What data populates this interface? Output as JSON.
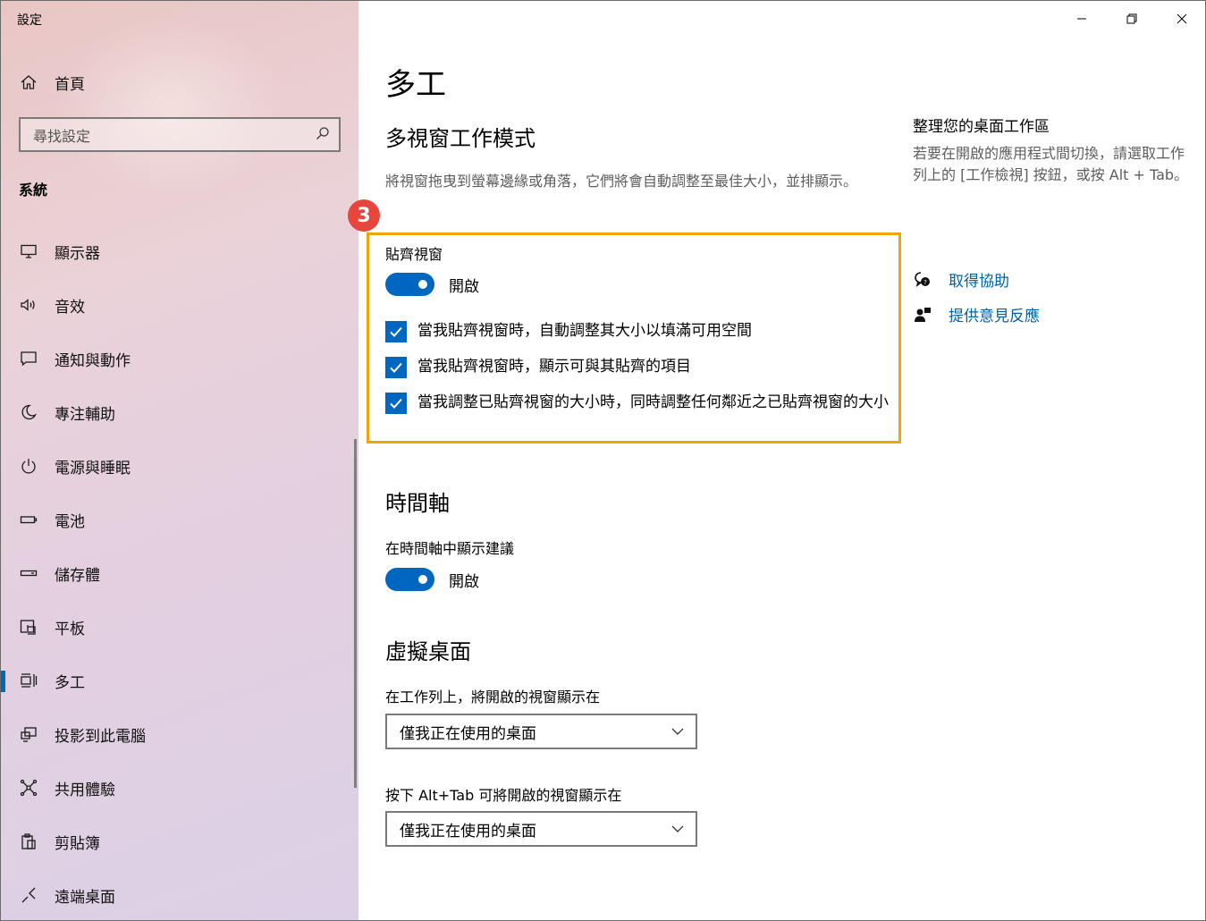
{
  "window": {
    "title": "設定",
    "minimize_icon": "minimize-icon",
    "restore_icon": "restore-icon",
    "close_icon": "close-icon"
  },
  "sidebar": {
    "home_label": "首頁",
    "search_placeholder": "尋找設定",
    "section_title": "系統",
    "items": [
      {
        "label": "顯示器",
        "icon": "monitor-icon"
      },
      {
        "label": "音效",
        "icon": "speaker-icon"
      },
      {
        "label": "通知與動作",
        "icon": "notification-icon"
      },
      {
        "label": "專注輔助",
        "icon": "moon-icon"
      },
      {
        "label": "電源與睡眠",
        "icon": "power-icon"
      },
      {
        "label": "電池",
        "icon": "battery-icon"
      },
      {
        "label": "儲存體",
        "icon": "storage-icon"
      },
      {
        "label": "平板",
        "icon": "tablet-icon"
      },
      {
        "label": "多工",
        "icon": "multitasking-icon",
        "selected": true
      },
      {
        "label": "投影到此電腦",
        "icon": "project-icon"
      },
      {
        "label": "共用體驗",
        "icon": "share-icon"
      },
      {
        "label": "剪貼簿",
        "icon": "clipboard-icon"
      },
      {
        "label": "遠端桌面",
        "icon": "remote-desktop-icon"
      }
    ]
  },
  "main": {
    "page_title": "多工",
    "snap": {
      "heading": "多視窗工作模式",
      "description": "將視窗拖曳到螢幕邊緣或角落，它們將會自動調整至最佳大小，並排顯示。",
      "badge": "3",
      "toggle_label": "貼齊視窗",
      "toggle_state": "開啟",
      "checkboxes": [
        {
          "label": "當我貼齊視窗時，自動調整其大小以填滿可用空間",
          "checked": true
        },
        {
          "label": "當我貼齊視窗時，顯示可與其貼齊的項目",
          "checked": true
        },
        {
          "label": "當我調整已貼齊視窗的大小時，同時調整任何鄰近之已貼齊視窗的大小",
          "checked": true
        }
      ]
    },
    "timeline": {
      "heading": "時間軸",
      "toggle_label": "在時間軸中顯示建議",
      "toggle_state": "開啟"
    },
    "virtual_desktops": {
      "heading": "虛擬桌面",
      "taskbar_label": "在工作列上，將開啟的視窗顯示在",
      "taskbar_value": "僅我正在使用的桌面",
      "alttab_label": "按下 Alt+Tab 可將開啟的視窗顯示在",
      "alttab_value": "僅我正在使用的桌面"
    }
  },
  "aside": {
    "title": "整理您的桌面工作區",
    "text": "若要在開啟的應用程式間切換，請選取工作列上的 [工作檢視] 按鈕，或按 Alt + Tab。",
    "help_link": "取得協助",
    "feedback_link": "提供意見反應"
  },
  "colors": {
    "accent": "#0067c0",
    "highlight": "#f0a30a",
    "badge": "#e8453c",
    "link": "#0062ad"
  }
}
